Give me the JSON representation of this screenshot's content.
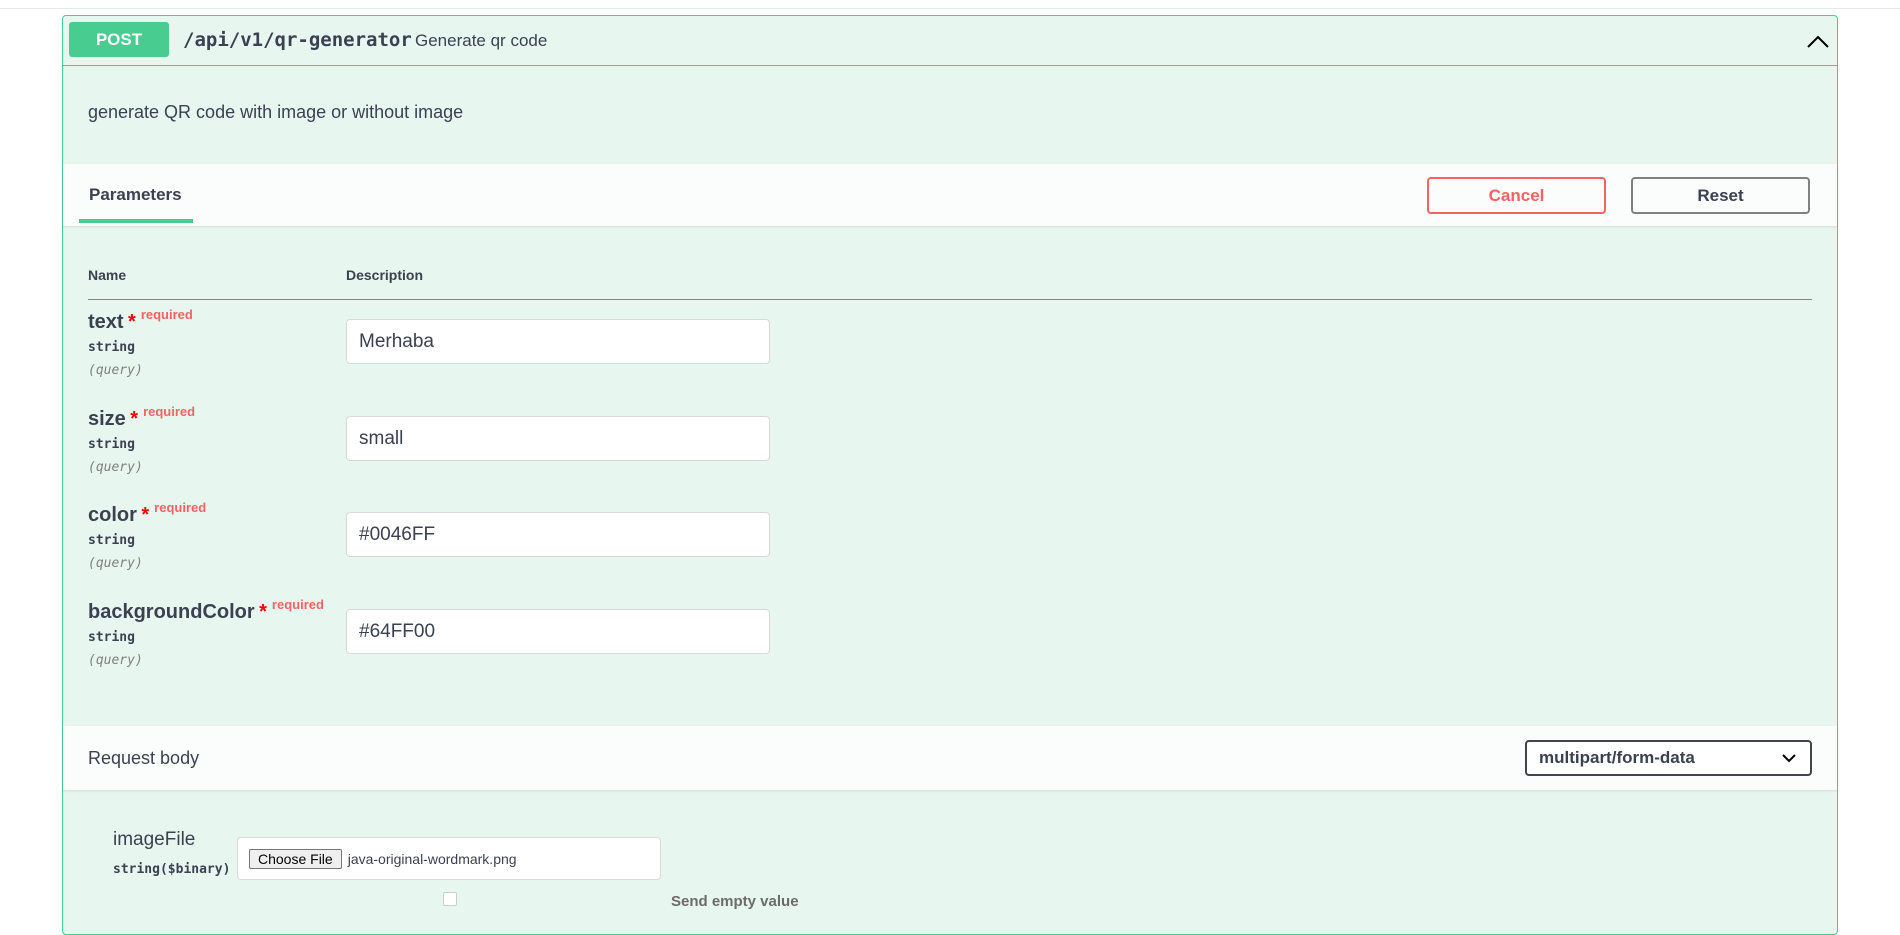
{
  "operation": {
    "method": "POST",
    "path": "/api/v1/qr-generator",
    "summary": "Generate qr code",
    "description": "generate QR code with image or without image"
  },
  "parameters": {
    "tab_label": "Parameters",
    "cancel_label": "Cancel",
    "reset_label": "Reset",
    "col_name": "Name",
    "col_description": "Description",
    "items": [
      {
        "name": "text",
        "star": "*",
        "required": "required",
        "type": "string",
        "in": "(query)",
        "value": "Merhaba"
      },
      {
        "name": "size",
        "star": "*",
        "required": "required",
        "type": "string",
        "in": "(query)",
        "value": "small"
      },
      {
        "name": "color",
        "star": "*",
        "required": "required",
        "type": "string",
        "in": "(query)",
        "value": "#0046FF"
      },
      {
        "name": "backgroundColor",
        "star": "*",
        "required": "required",
        "type": "string",
        "in": "(query)",
        "value": "#64FF00"
      }
    ]
  },
  "request_body": {
    "title": "Request body",
    "content_type": "multipart/form-data",
    "file_field": {
      "name": "imageFile",
      "type": "string($binary)",
      "button_label": "Choose File",
      "file_name": "java-original-wordmark.png"
    },
    "send_empty_label": "Send empty value"
  },
  "colors": {
    "post_green": "#49cc90",
    "block_background": "#e8f6f0",
    "cancel_red": "#ff6060"
  },
  "icons": {
    "collapse": "chevron-up-icon",
    "select": "chevron-down-icon"
  }
}
